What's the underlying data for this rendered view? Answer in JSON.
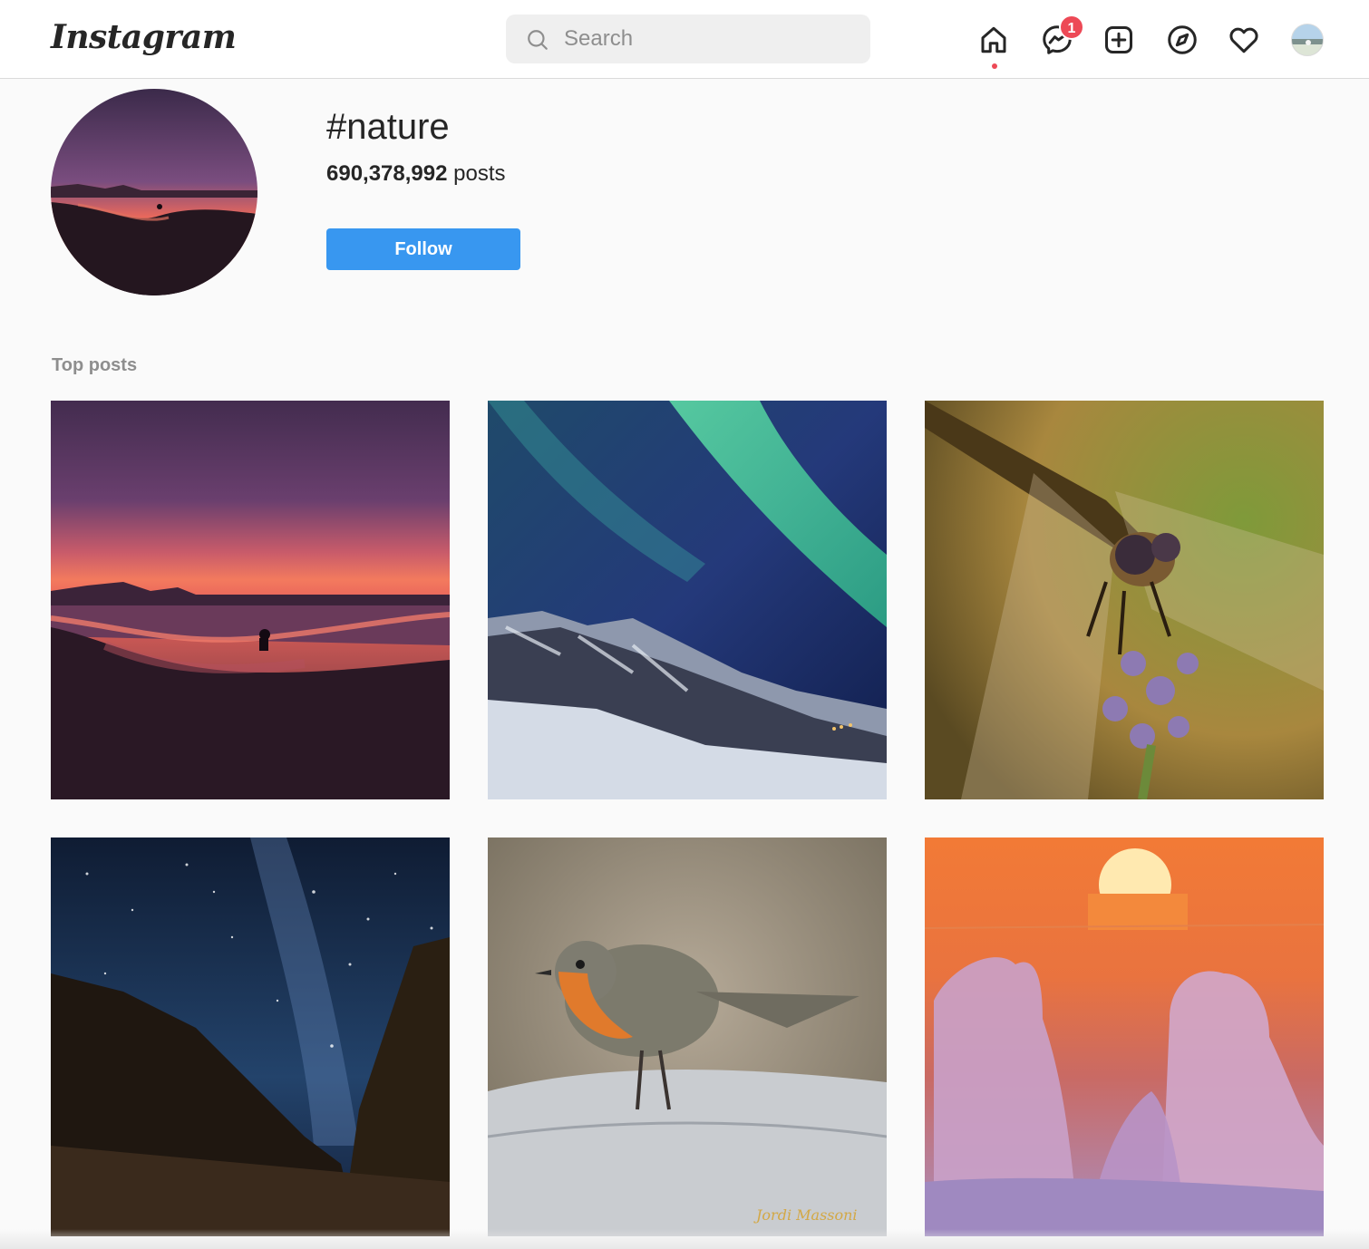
{
  "nav": {
    "logo": "Instagram",
    "search_placeholder": "Search",
    "messages_badge": "1",
    "icons": [
      "home-icon",
      "messenger-icon",
      "new-post-icon",
      "explore-icon",
      "activity-heart-icon",
      "profile-avatar"
    ]
  },
  "hashtag": {
    "title": "#nature",
    "post_count": "690,378,992",
    "post_suffix": "posts",
    "follow_label": "Follow"
  },
  "top_posts": {
    "label": "Top posts",
    "items": [
      {
        "subject": "sunset-beach"
      },
      {
        "subject": "aurora-mountains"
      },
      {
        "subject": "dragonfly-lavender"
      },
      {
        "subject": "milky-way-forest"
      },
      {
        "subject": "robin-on-log",
        "watermark": "Jordi Massoni"
      },
      {
        "subject": "snowy-trees-sunset"
      }
    ]
  },
  "colors": {
    "follow_blue": "#3897f0",
    "badge_red": "#ed4956",
    "page_bg": "#fafafa"
  }
}
